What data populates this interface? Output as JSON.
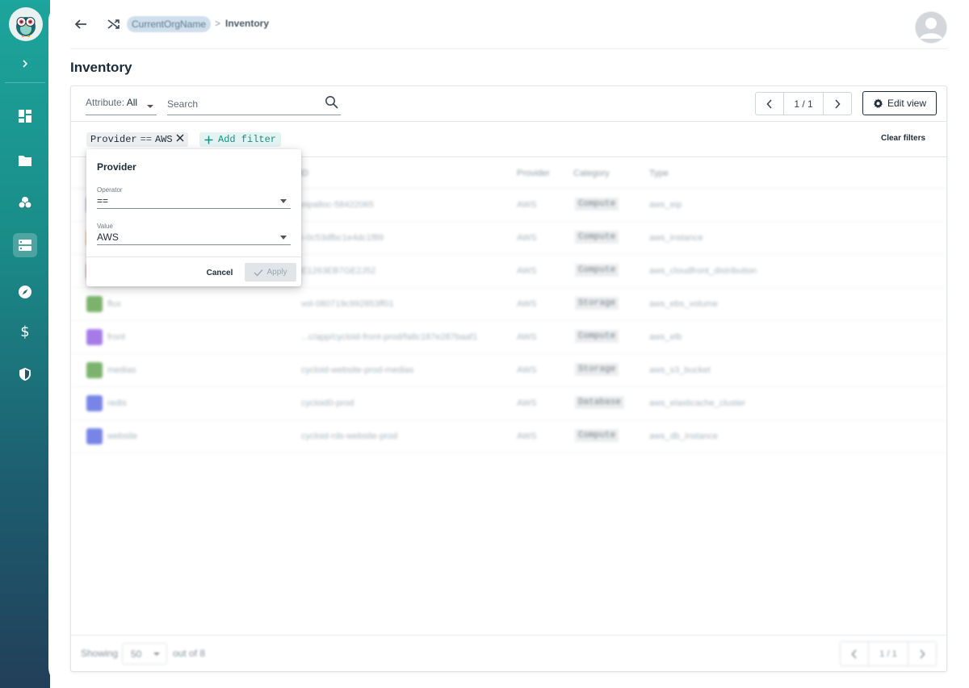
{
  "breadcrumb": {
    "org": "CurrentOrgName",
    "separator": ">",
    "current": "Inventory"
  },
  "page": {
    "title": "Inventory"
  },
  "toolbar": {
    "attribute_label": "Attribute:",
    "attribute_value": "All",
    "search_placeholder": "Search",
    "pagination": "1 / 1",
    "edit_view_label": "Edit view"
  },
  "filters": {
    "chip": {
      "field": "Provider",
      "operator": "==",
      "value": "AWS"
    },
    "add_filter_label": "Add filter",
    "clear_label": "Clear filters"
  },
  "popover": {
    "title": "Provider",
    "operator_label": "Operator",
    "operator_value": "==",
    "value_label": "Value",
    "value_value": "AWS",
    "cancel_label": "Cancel",
    "apply_label": "Apply"
  },
  "table": {
    "columns": [
      "ID",
      "Provider",
      "Category",
      "Type"
    ],
    "rows": [
      {
        "name": "",
        "id": "eipalloc-58422065",
        "provider": "AWS",
        "category": "Compute",
        "type": "aws_eip",
        "icon_color": "#6a5ee0"
      },
      {
        "name": "",
        "id": "i-0c53dfbc1e4dc1f89",
        "provider": "AWS",
        "category": "Compute",
        "type": "aws_instance",
        "icon_color": "#e07a30"
      },
      {
        "name": "",
        "id": "E1263EB7GE2J52",
        "provider": "AWS",
        "category": "Compute",
        "type": "aws_cloudfront_distribution",
        "icon_color": "#d04a4a"
      },
      {
        "name": "flux",
        "id": "vol-080719c992853ff01",
        "provider": "AWS",
        "category": "Storage",
        "type": "aws_ebs_volume",
        "icon_color": "#4f9a3c"
      },
      {
        "name": "front",
        "id": "...c/app/cycloid-front-prod/fa8c187e287baaf1",
        "provider": "AWS",
        "category": "Compute",
        "type": "aws_elb",
        "icon_color": "#8a4fe0"
      },
      {
        "name": "medias",
        "id": "cycloid-website-prod-medias",
        "provider": "AWS",
        "category": "Storage",
        "type": "aws_s3_bucket",
        "icon_color": "#4f9a3c"
      },
      {
        "name": "redis",
        "id": "cycloid0-prod",
        "provider": "AWS",
        "category": "Database",
        "type": "aws_elasticache_cluster",
        "icon_color": "#4a5de0"
      },
      {
        "name": "website",
        "id": "cycloid-rds-website-prod",
        "provider": "AWS",
        "category": "Compute",
        "type": "aws_db_instance",
        "icon_color": "#4a5de0"
      }
    ]
  },
  "footer": {
    "showing_label": "Showing",
    "per_page": "50",
    "out_of": "out of 8",
    "pagination": "1 / 1"
  },
  "colors": {
    "accent": "#1c8c82",
    "sidebar_top": "#1ca59c",
    "sidebar_bottom": "#223f59"
  }
}
